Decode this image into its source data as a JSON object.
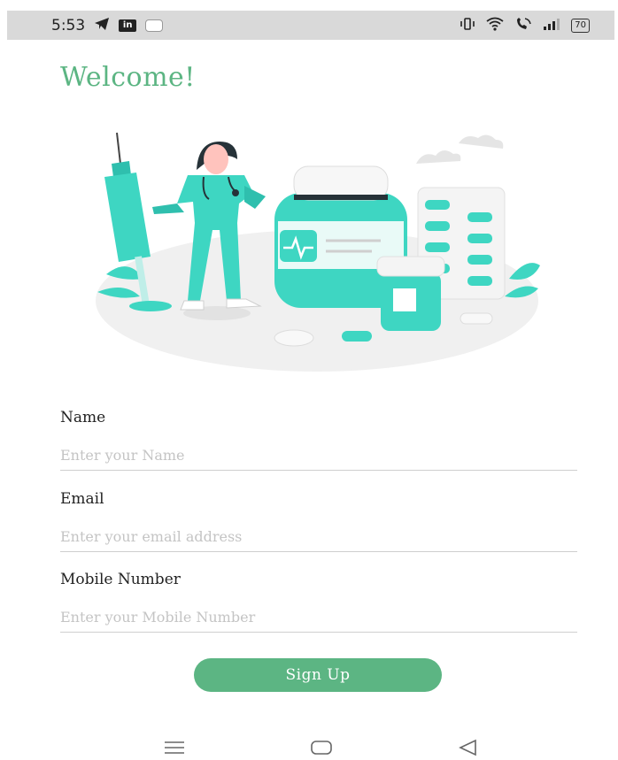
{
  "status": {
    "time": "5:53",
    "linkedin": "in",
    "battery": "70"
  },
  "page": {
    "title": "Welcome!"
  },
  "form": {
    "name_label": "Name",
    "name_placeholder": "Enter your Name",
    "email_label": "Email",
    "email_placeholder": "Enter your email address",
    "mobile_label": "Mobile Number",
    "mobile_placeholder": "Enter your Mobile Number",
    "signup_label": "Sign Up"
  },
  "colors": {
    "accent": "#5cb583",
    "teal": "#3ed6c2"
  },
  "icons": [
    "telegram-icon",
    "linkedin-icon",
    "message-icon",
    "vibrate-icon",
    "wifi-icon",
    "wifi-calling-icon",
    "signal-icon",
    "battery-icon",
    "menu-icon",
    "home-icon",
    "back-icon"
  ]
}
